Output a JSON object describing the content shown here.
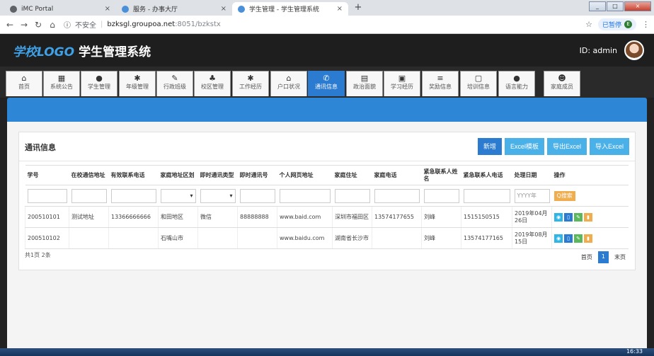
{
  "browser": {
    "tabs": [
      {
        "label": "iMC Portal",
        "active": false
      },
      {
        "label": "服务 - 办事大厅",
        "active": false
      },
      {
        "label": "学生管理 - 学生管理系统",
        "active": true
      }
    ],
    "new_tab": "+",
    "url_insecure": "不安全",
    "url_host": "bzksgl.groupoa.net",
    "url_path": ":8051/bzkstx",
    "paused_label": "已暂停",
    "paused_avatar": "E"
  },
  "app": {
    "logo": "学校LOGO",
    "title": "学生管理系统",
    "user_id": "ID: admin"
  },
  "nav": [
    {
      "icon": "home-icon",
      "glyph": "⌂",
      "label": "首页"
    },
    {
      "icon": "chart-icon",
      "glyph": "▦",
      "label": "系统公告"
    },
    {
      "icon": "user-icon",
      "glyph": "●",
      "label": "学生管理"
    },
    {
      "icon": "gear-icon",
      "glyph": "✱",
      "label": "年级管理"
    },
    {
      "icon": "edit-icon",
      "glyph": "✎",
      "label": "行政班级"
    },
    {
      "icon": "sitemap-icon",
      "glyph": "♣",
      "label": "校区管理"
    },
    {
      "icon": "asterisk-icon",
      "glyph": "✱",
      "label": "工作经历"
    },
    {
      "icon": "house-icon",
      "glyph": "⌂",
      "label": "户口状况"
    },
    {
      "icon": "phone-icon",
      "glyph": "✆",
      "label": "通讯信息",
      "active": true
    },
    {
      "icon": "file-icon",
      "glyph": "▤",
      "label": "政治面貌"
    },
    {
      "icon": "briefcase-icon",
      "glyph": "▣",
      "label": "学习经历"
    },
    {
      "icon": "list-icon",
      "glyph": "≡",
      "label": "奖励信息"
    },
    {
      "icon": "calendar-icon",
      "glyph": "▢",
      "label": "培训信息"
    },
    {
      "icon": "comment-icon",
      "glyph": "●",
      "label": "语言能力"
    },
    {
      "icon": "family-icon",
      "glyph": "☻",
      "label": "家庭成员"
    }
  ],
  "panel": {
    "title": "通讯信息",
    "buttons": {
      "add": "新增",
      "template": "Excel模板",
      "export": "导出Excel",
      "import": "导入Excel"
    },
    "columns": [
      "学号",
      "在校通信地址",
      "有效联系电话",
      "家庭地址区划",
      "即时通讯类型",
      "即时通讯号",
      "个人网页地址",
      "家庭住址",
      "家庭电话",
      "紧急联系人姓名",
      "紧急联系人电话",
      "处理日期",
      "操作"
    ],
    "date_placeholder": "YYYY年",
    "search_label": "Q搜索",
    "rows": [
      [
        "200510101",
        "测试地址",
        "13366666666",
        "和田地区",
        "微信",
        "88888888",
        "www.baid.com",
        "深圳市福田区",
        "13574177655",
        "刘峰",
        "1515150515",
        "2019年04月26日"
      ],
      [
        "200510102",
        "",
        "",
        "石嘴山市",
        "",
        "",
        "www.baidu.com",
        "湖南省长沙市",
        "",
        "刘峰",
        "13574177165",
        "2019年08月15日"
      ]
    ],
    "summary": "共1页 2条",
    "pager": {
      "first": "首页",
      "current": "1",
      "last": "末页"
    }
  },
  "taskbar": {
    "clock": "16:33"
  }
}
